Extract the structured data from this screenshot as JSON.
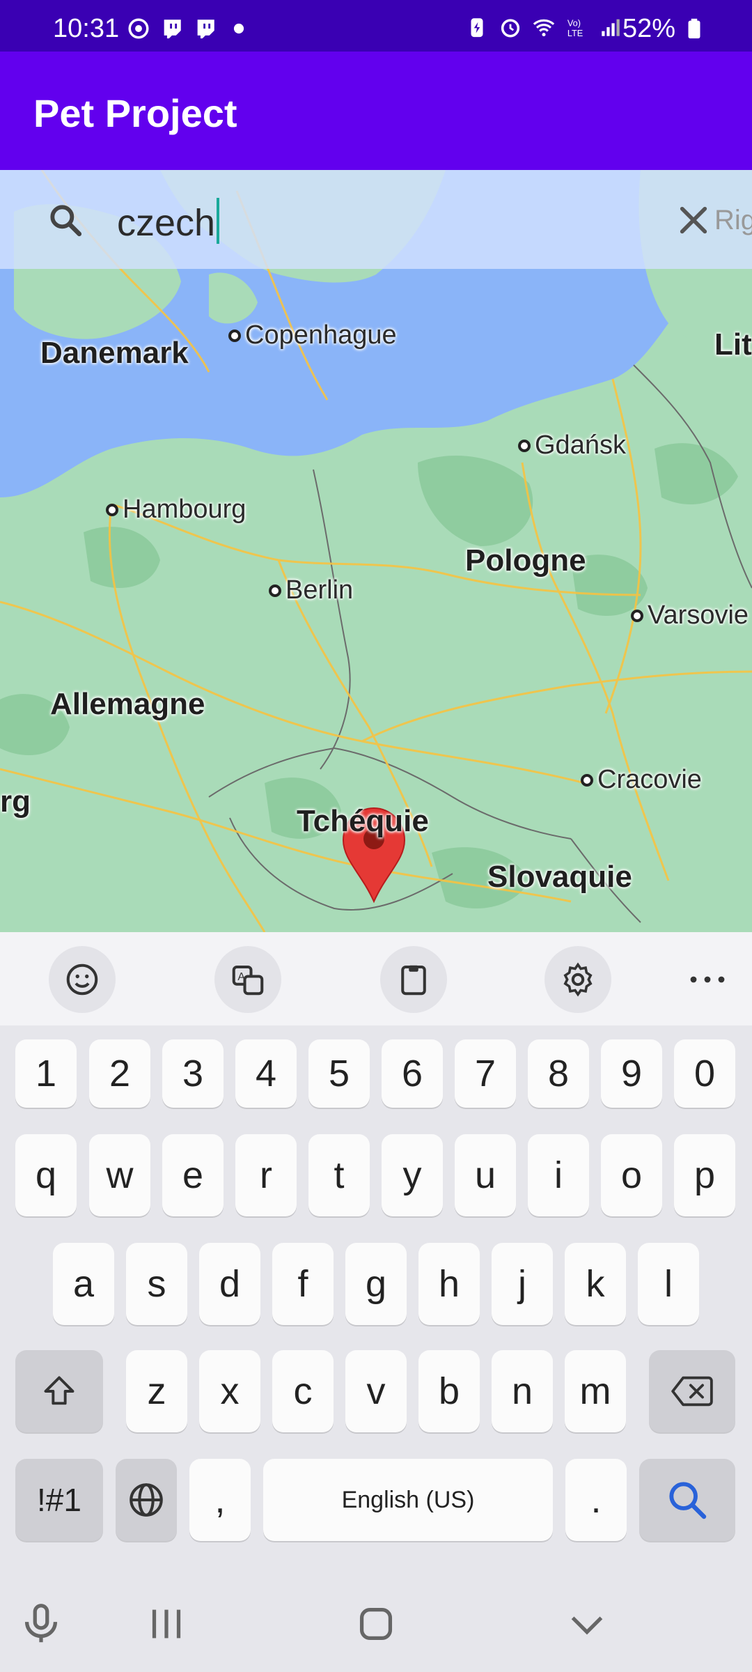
{
  "status_bar": {
    "time": "10:31",
    "battery": "52%",
    "icons": [
      "chrome-icon",
      "twitch-icon",
      "twitch-icon",
      "dot-icon",
      "battery-saver-icon",
      "alarm-icon",
      "wifi-icon",
      "volte-icon",
      "signal-icon",
      "battery-icon"
    ]
  },
  "app_bar": {
    "title": "Pet Project"
  },
  "search": {
    "query": "czech",
    "icon": "search-icon",
    "clear_icon": "close-icon"
  },
  "map": {
    "countries": {
      "denmark": "Danemark",
      "poland": "Pologne",
      "germany": "Allemagne",
      "czechia": "Tchéquie",
      "slovakia": "Slovaquie",
      "lithuania_partial": "Lit",
      "riga_partial": "Rig",
      "partial_left": "rg"
    },
    "cities": {
      "copenhagen": "Copenhague",
      "gdansk": "Gdańsk",
      "hamburg": "Hambourg",
      "berlin": "Berlin",
      "warsaw": "Varsovie",
      "krakow": "Cracovie"
    },
    "marker": "location-pin-icon",
    "colors": {
      "land": "#a9dbb8",
      "water": "#8ab4f8",
      "roads": "#f6c343",
      "forest": "#8fcc9f",
      "marker": "#e53935"
    }
  },
  "keyboard": {
    "toolbar": [
      "emoji-icon",
      "translate-icon",
      "clipboard-icon",
      "settings-icon",
      "more-icon"
    ],
    "row_numbers": [
      "1",
      "2",
      "3",
      "4",
      "5",
      "6",
      "7",
      "8",
      "9",
      "0"
    ],
    "row1": [
      "q",
      "w",
      "e",
      "r",
      "t",
      "y",
      "u",
      "i",
      "o",
      "p"
    ],
    "row2": [
      "a",
      "s",
      "d",
      "f",
      "g",
      "h",
      "j",
      "k",
      "l"
    ],
    "row3": [
      "z",
      "x",
      "c",
      "v",
      "b",
      "n",
      "m"
    ],
    "symbols_label": "!#1",
    "comma": ",",
    "space_label": "English (US)",
    "period": "."
  },
  "nav_bar": [
    "mic-icon",
    "recents-icon",
    "home-icon",
    "hide-keyboard-icon"
  ]
}
